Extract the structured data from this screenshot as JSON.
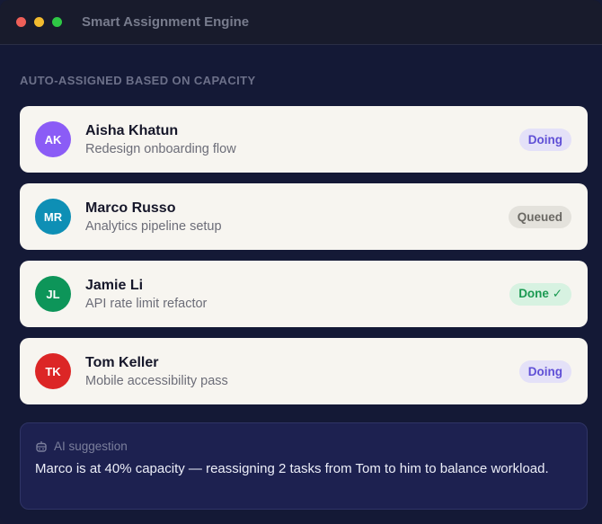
{
  "window": {
    "title": "Smart Assignment Engine"
  },
  "section_label": "AUTO-ASSIGNED BASED ON CAPACITY",
  "assignments": [
    {
      "initials": "AK",
      "name": "Aisha Khatun",
      "task": "Redesign onboarding flow",
      "status": "Doing",
      "avatar_color": "#8b5cf6",
      "badge_bg": "#e4e1f8",
      "badge_color": "#5f4fd6"
    },
    {
      "initials": "MR",
      "name": "Marco Russo",
      "task": "Analytics pipeline setup",
      "status": "Queued",
      "avatar_color": "#0e8fb5",
      "badge_bg": "#e4e2dc",
      "badge_color": "#6a6863"
    },
    {
      "initials": "JL",
      "name": "Jamie Li",
      "task": "API rate limit refactor",
      "status": "Done ✓",
      "avatar_color": "#0d9559",
      "badge_bg": "#d7f2e1",
      "badge_color": "#1b9a52"
    },
    {
      "initials": "TK",
      "name": "Tom Keller",
      "task": "Mobile accessibility pass",
      "status": "Doing",
      "avatar_color": "#dc2626",
      "badge_bg": "#e4e1f8",
      "badge_color": "#5f4fd6"
    }
  ],
  "suggestion": {
    "icon": "robot-icon",
    "label": "AI suggestion",
    "text": "Marco is at 40% capacity — reassigning 2 tasks from Tom to him to balance workload."
  }
}
